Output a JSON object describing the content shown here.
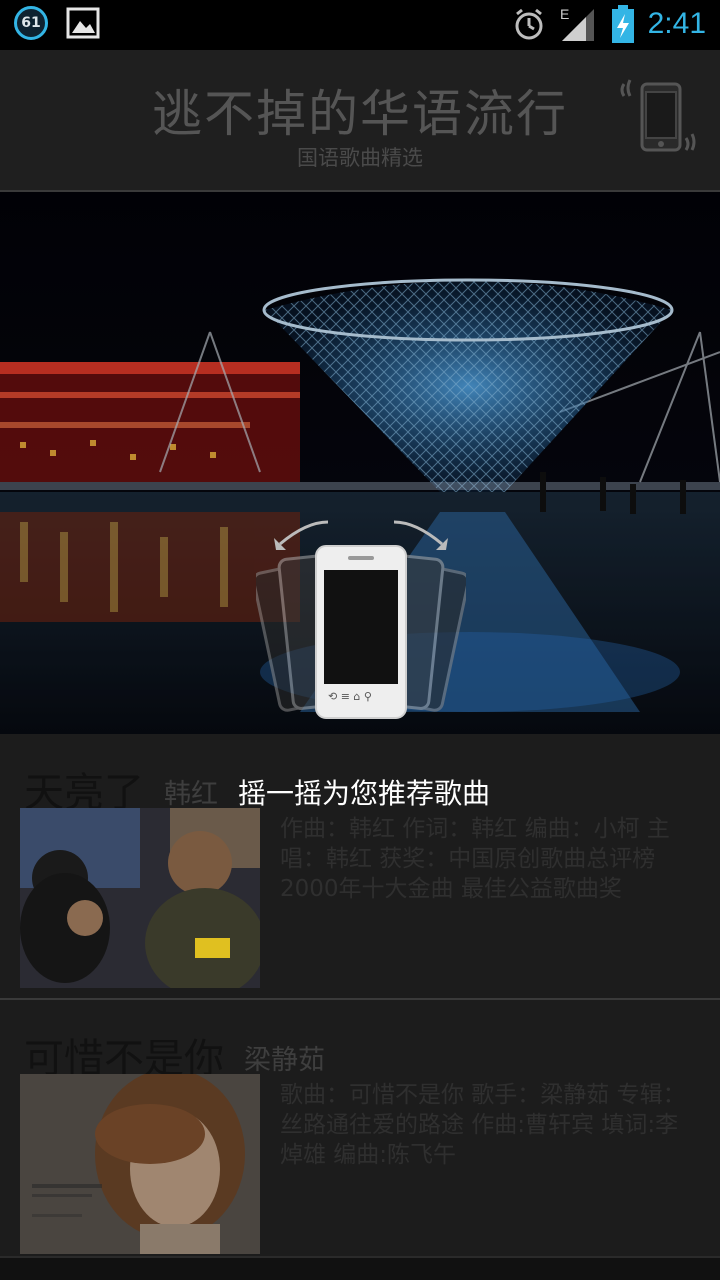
{
  "status_bar": {
    "notification_count": "61",
    "time": "2:41",
    "network_label": "E",
    "icons": [
      "notification-badge",
      "image-icon",
      "alarm-icon",
      "signal-icon",
      "battery-charging-icon"
    ]
  },
  "header": {
    "title": "逃不掉的华语流行",
    "subtitle": "国语歌曲精选",
    "icon": "shake-phone-icon"
  },
  "overlay": {
    "hint": "摇一摇为您推荐歌曲",
    "icon": "shake-phone-icon"
  },
  "songs": [
    {
      "title": "天亮了",
      "artist": "韩红",
      "description": "作曲：韩红  作词：韩红  编曲：小柯  主唱：韩红  获奖：中国原创歌曲总评榜 2000年十大金曲  最佳公益歌曲奖"
    },
    {
      "title": "可惜不是你",
      "artist": "梁静茹",
      "description": "歌曲：可惜不是你  歌手：梁静茹  专辑：丝路通往爱的路途  作曲:曹轩宾  填词:李焯雄  编曲:陈飞午"
    }
  ],
  "colors": {
    "accent": "#33b5e5",
    "background": "#1c1c1c"
  }
}
